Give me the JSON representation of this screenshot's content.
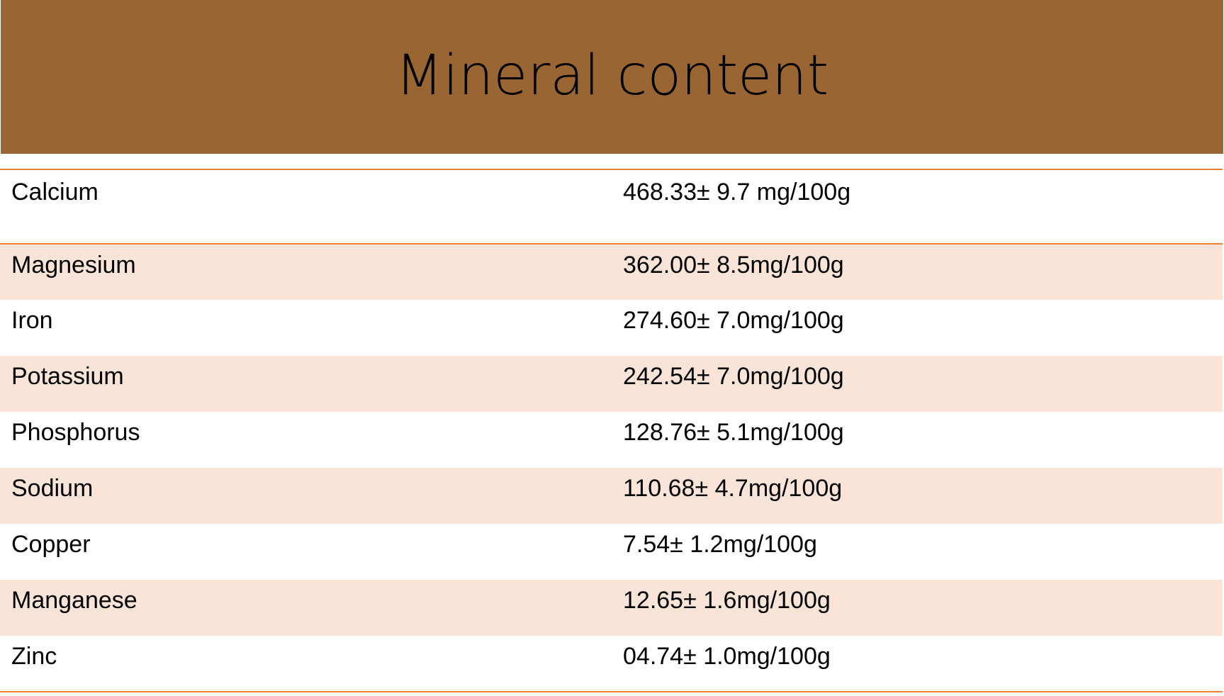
{
  "colors": {
    "title_bg": "#996633",
    "band_bg": "#F9E4D7",
    "rule": "#ED7D31"
  },
  "title": "Mineral content",
  "rows": [
    {
      "mineral": "Calcium",
      "value": "468.33± 9.7 mg/100g"
    },
    {
      "mineral": "Magnesium",
      "value": "362.00± 8.5mg/100g"
    },
    {
      "mineral": "Iron",
      "value": "274.60± 7.0mg/100g"
    },
    {
      "mineral": "Potassium",
      "value": "242.54± 7.0mg/100g"
    },
    {
      "mineral": "Phosphorus",
      "value": "128.76± 5.1mg/100g"
    },
    {
      "mineral": "Sodium",
      "value": "110.68± 4.7mg/100g"
    },
    {
      "mineral": "Copper",
      "value": "7.54± 1.2mg/100g"
    },
    {
      "mineral": "Manganese",
      "value": "12.65± 1.6mg/100g"
    },
    {
      "mineral": "Zinc",
      "value": "04.74± 1.0mg/100g"
    }
  ]
}
